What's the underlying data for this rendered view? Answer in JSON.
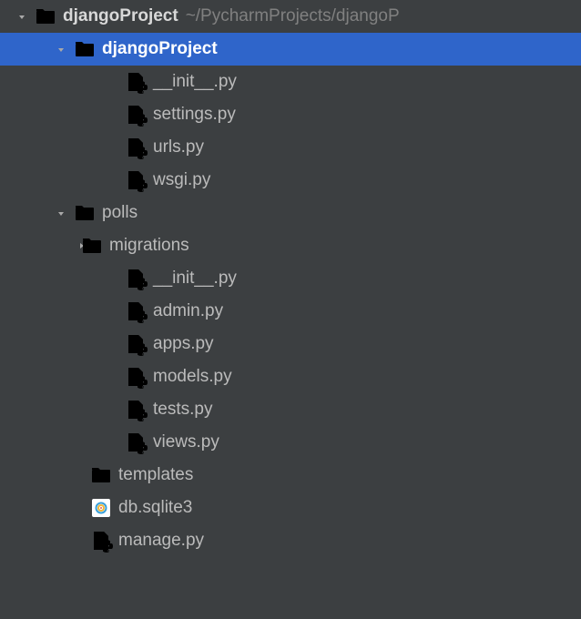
{
  "tree": {
    "root": {
      "label": "djangoProject",
      "path_hint": "~/PycharmProjects/djangoP"
    },
    "djangoProject_pkg": {
      "label": "djangoProject"
    },
    "djangoProject_pkg_children": {
      "init": {
        "label": "__init__.py"
      },
      "settings": {
        "label": "settings.py"
      },
      "urls": {
        "label": "urls.py"
      },
      "wsgi": {
        "label": "wsgi.py"
      }
    },
    "polls": {
      "label": "polls"
    },
    "polls_children": {
      "migrations": {
        "label": "migrations"
      },
      "init": {
        "label": "__init__.py"
      },
      "admin": {
        "label": "admin.py"
      },
      "apps": {
        "label": "apps.py"
      },
      "models": {
        "label": "models.py"
      },
      "tests": {
        "label": "tests.py"
      },
      "views": {
        "label": "views.py"
      }
    },
    "templates": {
      "label": "templates"
    },
    "db": {
      "label": "db.sqlite3"
    },
    "manage": {
      "label": "manage.py"
    }
  }
}
